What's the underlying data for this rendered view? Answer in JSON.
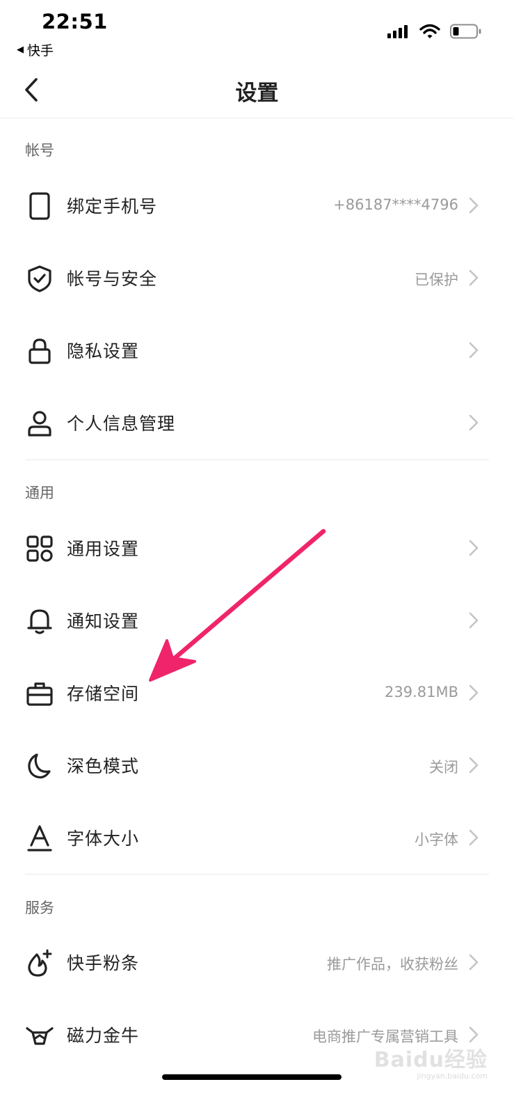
{
  "status_bar": {
    "time": "22:51",
    "back_app_label": "快手"
  },
  "nav": {
    "title": "设置"
  },
  "sections": [
    {
      "header": "帐号",
      "rows": [
        {
          "icon": "phone-icon",
          "label": "绑定手机号",
          "value": "+86187****4796"
        },
        {
          "icon": "shield-check-icon",
          "label": "帐号与安全",
          "value": "已保护"
        },
        {
          "icon": "lock-icon",
          "label": "隐私设置",
          "value": ""
        },
        {
          "icon": "person-icon",
          "label": "个人信息管理",
          "value": ""
        }
      ]
    },
    {
      "header": "通用",
      "rows": [
        {
          "icon": "grid-icon",
          "label": "通用设置",
          "value": ""
        },
        {
          "icon": "bell-icon",
          "label": "通知设置",
          "value": ""
        },
        {
          "icon": "storage-box-icon",
          "label": "存储空间",
          "value": "239.81MB"
        },
        {
          "icon": "moon-icon",
          "label": "深色模式",
          "value": "关闭"
        },
        {
          "icon": "font-size-icon",
          "label": "字体大小",
          "value": "小字体"
        }
      ]
    },
    {
      "header": "服务",
      "rows": [
        {
          "icon": "flame-plus-icon",
          "label": "快手粉条",
          "value": "推广作品，收获粉丝"
        },
        {
          "icon": "bull-icon",
          "label": "磁力金牛",
          "value": "电商推广专属营销工具"
        }
      ]
    }
  ],
  "annotation": {
    "color": "#f0246a"
  },
  "watermark": {
    "mark": "Baidu经验",
    "url": "jingyan.baidu.com"
  }
}
